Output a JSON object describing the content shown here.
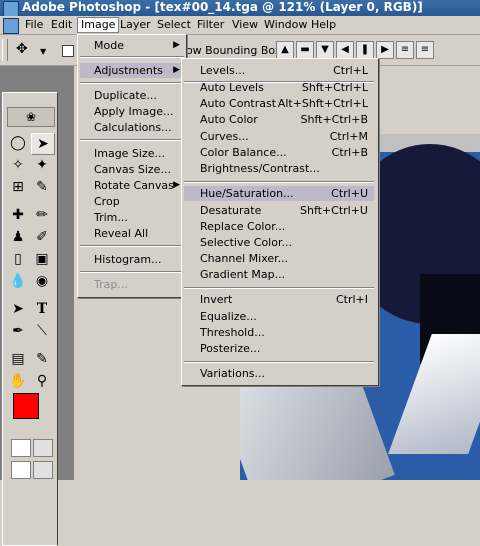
{
  "window": {
    "title": "Adobe Photoshop - [tex#00_14.tga @ 121% (Layer 0, RGB)]"
  },
  "menubar": [
    "File",
    "Edit",
    "Image",
    "Layer",
    "Select",
    "Filter",
    "View",
    "Window",
    "Help"
  ],
  "options": {
    "bounding_label": "Show Bounding Box"
  },
  "image_menu": {
    "items": [
      "Mode",
      "Adjustments",
      "Duplicate...",
      "Apply Image...",
      "Calculations...",
      "Image Size...",
      "Canvas Size...",
      "Rotate Canvas",
      "Crop",
      "Trim...",
      "Reveal All",
      "Histogram...",
      "Trap..."
    ]
  },
  "adjustments_menu": {
    "items": [
      {
        "label": "Levels...",
        "shortcut": "Ctrl+L"
      },
      {
        "label": "Auto Levels",
        "shortcut": "Shft+Ctrl+L"
      },
      {
        "label": "Auto Contrast",
        "shortcut": "Alt+Shft+Ctrl+L"
      },
      {
        "label": "Auto Color",
        "shortcut": "Shft+Ctrl+B"
      },
      {
        "label": "Curves...",
        "shortcut": "Ctrl+M"
      },
      {
        "label": "Color Balance...",
        "shortcut": "Ctrl+B"
      },
      {
        "label": "Brightness/Contrast...",
        "shortcut": ""
      },
      {
        "label": "Hue/Saturation...",
        "shortcut": "Ctrl+U"
      },
      {
        "label": "Desaturate",
        "shortcut": "Shft+Ctrl+U"
      },
      {
        "label": "Replace Color...",
        "shortcut": ""
      },
      {
        "label": "Selective Color...",
        "shortcut": ""
      },
      {
        "label": "Channel Mixer...",
        "shortcut": ""
      },
      {
        "label": "Gradient Map...",
        "shortcut": ""
      },
      {
        "label": "Invert",
        "shortcut": "Ctrl+I"
      },
      {
        "label": "Equalize...",
        "shortcut": ""
      },
      {
        "label": "Threshold...",
        "shortcut": ""
      },
      {
        "label": "Posterize...",
        "shortcut": ""
      },
      {
        "label": "Variations...",
        "shortcut": ""
      }
    ]
  },
  "tools": {
    "type_glyph": "T"
  },
  "colors": {
    "foreground": "#ff0000",
    "background": "#000000",
    "highlight": "#bdb9c8",
    "titlebar": "#2a5894"
  }
}
